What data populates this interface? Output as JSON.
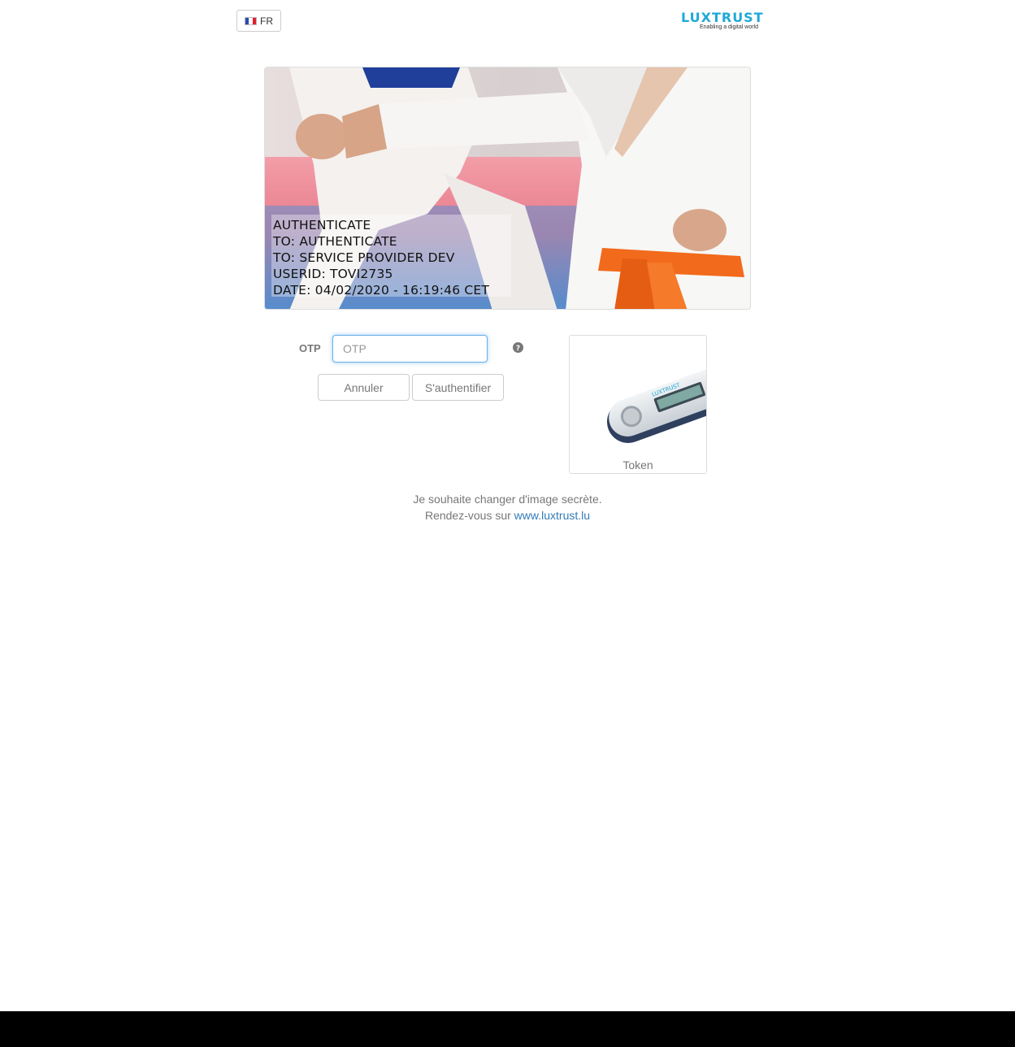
{
  "language": {
    "code": "FR",
    "flag_icon": "flag-fr-icon"
  },
  "brand": {
    "name": "LUXTRUST",
    "tagline": "Enabling a digital world",
    "color": "#1fa8d8"
  },
  "secret_image": {
    "lines": [
      "AUTHENTICATE",
      "TO: AUTHENTICATE",
      "TO: SERVICE PROVIDER DEV",
      "USERID: TOVI2735",
      "DATE: 04/02/2020 - 16:19:46 CET"
    ]
  },
  "form": {
    "otp_label": "OTP",
    "otp_placeholder": "OTP",
    "otp_value": "",
    "cancel_label": "Annuler",
    "submit_label": "S'authentifier",
    "help_icon": "question-circle-icon"
  },
  "device": {
    "label": "Token",
    "brand": "LUXTRUST"
  },
  "footer": {
    "line1": "Je souhaite changer d'image secrète.",
    "line2_prefix": "Rendez-vous sur",
    "link_text": "www.luxtrust.lu"
  },
  "colors": {
    "link": "#337ab7",
    "focus": "#66afe9",
    "belt": "#f26a1b"
  }
}
